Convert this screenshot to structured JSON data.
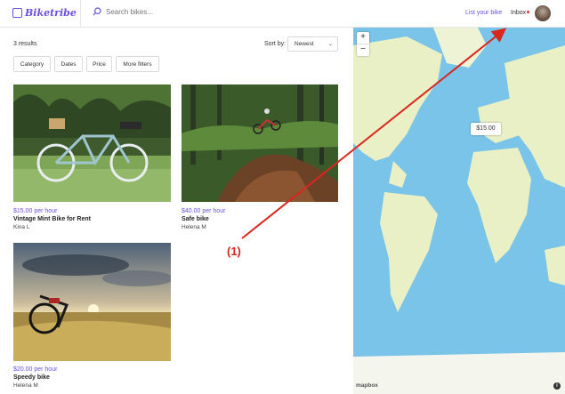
{
  "header": {
    "logo_text": "Biketribe",
    "search_placeholder": "Search bikes...",
    "list_link": "List your bike",
    "inbox": "Inbox"
  },
  "toolbar": {
    "results": "3 results",
    "sort_label": "Sort by:",
    "sort_value": "Newest",
    "filters": [
      "Category",
      "Dates",
      "Price",
      "More filters"
    ]
  },
  "listings": [
    {
      "price": "$15.00 per hour",
      "title": "Vintage Mint Bike for Rent",
      "owner": "Kina L"
    },
    {
      "price": "$40.00 per hour",
      "title": "Safe bike",
      "owner": "Helena M"
    },
    {
      "price": "$20.00 per hour",
      "title": "Speedy bike",
      "owner": "Helena M"
    }
  ],
  "map": {
    "price_marker": "$15.00",
    "zoom_in": "+",
    "zoom_out": "−",
    "attribution": "mapbox",
    "info": "i"
  },
  "annotation": {
    "label": "(1)"
  },
  "colors": {
    "accent": "#6b4fe0",
    "annotation": "#d9261f",
    "ocean": "#79c4e8",
    "land": "#eaf0c6"
  }
}
